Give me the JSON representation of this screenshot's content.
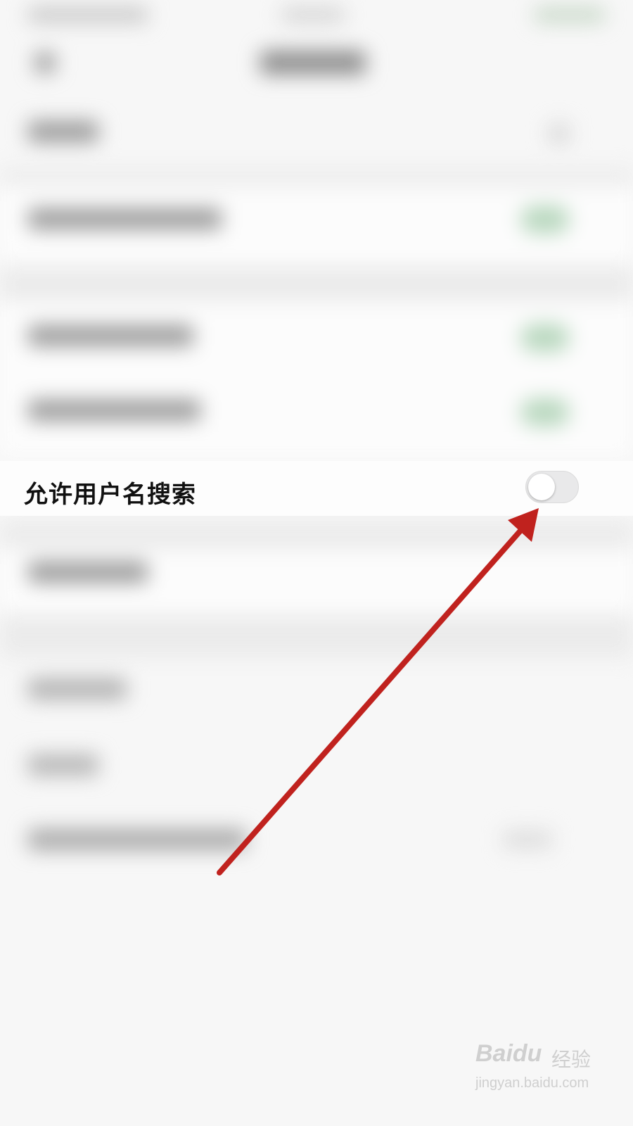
{
  "setting": {
    "label": "允许用户名搜索",
    "enabled": false
  },
  "annotation": {
    "arrow_color": "#c0221e"
  },
  "watermark": {
    "logo": "Baidu",
    "cn": "经验",
    "url": "jingyan.baidu.com"
  },
  "colors": {
    "toggle_off": "#e9e9ea",
    "toggle_on_blurred": "#b9d8bf",
    "text": "#111111"
  }
}
